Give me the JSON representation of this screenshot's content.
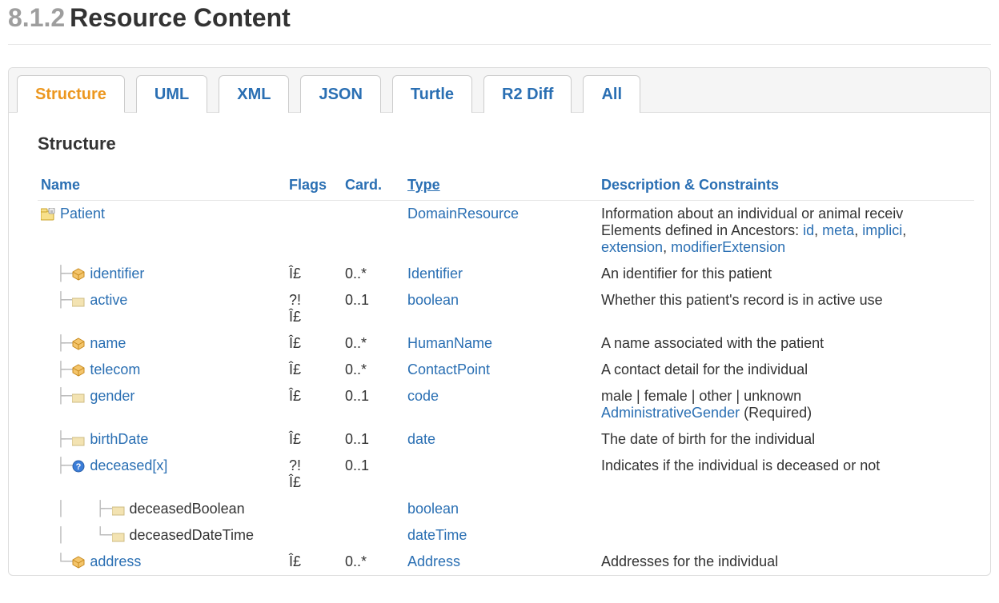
{
  "header": {
    "number": "8.1.2",
    "title": "Resource Content"
  },
  "tabs": [
    {
      "label": "Structure",
      "active": true
    },
    {
      "label": "UML",
      "active": false
    },
    {
      "label": "XML",
      "active": false
    },
    {
      "label": "JSON",
      "active": false
    },
    {
      "label": "Turtle",
      "active": false
    },
    {
      "label": "R2 Diff",
      "active": false
    },
    {
      "label": "All",
      "active": false
    }
  ],
  "subheading": "Structure",
  "columns": {
    "name": "Name",
    "flags": "Flags",
    "card": "Card.",
    "type": "Type",
    "desc": "Description & Constraints"
  },
  "rows": [
    {
      "indent": 0,
      "icon": "resource",
      "name": "Patient",
      "nameLink": true,
      "flags": "",
      "card": "",
      "type": "DomainResource",
      "typeLink": true,
      "descPrefix": "Information about an individual or animal receiv",
      "descLine2Prefix": "Elements defined in Ancestors: ",
      "ancestorLinks": [
        "id",
        "meta",
        "implici",
        "extension",
        "modifierExtension"
      ]
    },
    {
      "indent": 1,
      "icon": "datatype",
      "name": "identifier",
      "nameLink": true,
      "flags": "Î£",
      "card": "0..*",
      "type": "Identifier",
      "typeLink": true,
      "desc": "An identifier for this patient"
    },
    {
      "indent": 1,
      "icon": "primitive",
      "name": "active",
      "nameLink": true,
      "flags": "?!\nÎ£",
      "card": "0..1",
      "type": "boolean",
      "typeLink": true,
      "desc": "Whether this patient's record is in active use"
    },
    {
      "indent": 1,
      "icon": "datatype",
      "name": "name",
      "nameLink": true,
      "flags": "Î£",
      "card": "0..*",
      "type": "HumanName",
      "typeLink": true,
      "desc": "A name associated with the patient"
    },
    {
      "indent": 1,
      "icon": "datatype",
      "name": "telecom",
      "nameLink": true,
      "flags": "Î£",
      "card": "0..*",
      "type": "ContactPoint",
      "typeLink": true,
      "desc": "A contact detail for the individual"
    },
    {
      "indent": 1,
      "icon": "primitive",
      "name": "gender",
      "nameLink": true,
      "flags": "Î£",
      "card": "0..1",
      "type": "code",
      "typeLink": true,
      "desc": "male | female | other | unknown",
      "bindingLink": "AdministrativeGender",
      "bindingStrength": "(Required)"
    },
    {
      "indent": 1,
      "icon": "primitive",
      "name": "birthDate",
      "nameLink": true,
      "flags": "Î£",
      "card": "0..1",
      "type": "date",
      "typeLink": true,
      "desc": "The date of birth for the individual"
    },
    {
      "indent": 1,
      "icon": "choice",
      "name": "deceased[x]",
      "nameLink": true,
      "flags": "?!\nÎ£",
      "card": "0..1",
      "type": "",
      "typeLink": false,
      "desc": "Indicates if the individual is deceased or not"
    },
    {
      "indent": 2,
      "icon": "primitive",
      "name": "deceasedBoolean",
      "nameLink": false,
      "flags": "",
      "card": "",
      "type": "boolean",
      "typeLink": true,
      "desc": ""
    },
    {
      "indent": 2,
      "icon": "primitive",
      "name": "deceasedDateTime",
      "nameLink": false,
      "flags": "",
      "card": "",
      "type": "dateTime",
      "typeLink": true,
      "desc": ""
    },
    {
      "indent": 1,
      "icon": "datatype",
      "name": "address",
      "nameLink": true,
      "flags": "Î£",
      "card": "0..*",
      "type": "Address",
      "typeLink": true,
      "desc": "Addresses for the individual"
    }
  ]
}
